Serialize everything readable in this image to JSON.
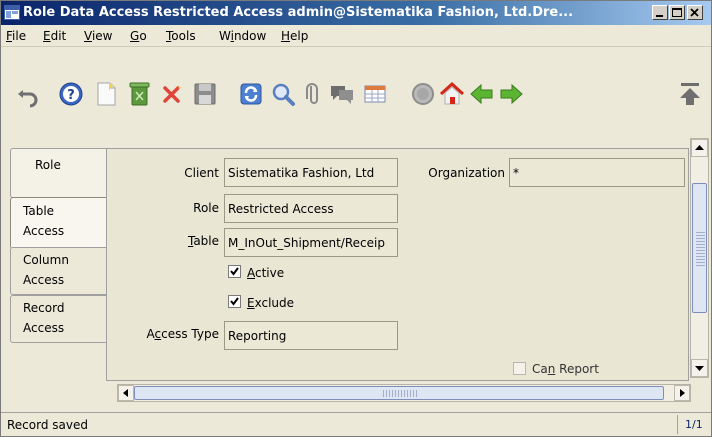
{
  "window": {
    "title": "Role Data Access  Restricted Access  admin@Sistematika Fashion, Ltd.Dre...",
    "controls": [
      "minimize",
      "maximize",
      "close"
    ]
  },
  "menu": [
    {
      "pre": "",
      "u": "F",
      "post": "ile"
    },
    {
      "pre": "",
      "u": "E",
      "post": "dit"
    },
    {
      "pre": "",
      "u": "V",
      "post": "iew"
    },
    {
      "pre": "",
      "u": "G",
      "post": "o"
    },
    {
      "pre": "",
      "u": "T",
      "post": "ools"
    },
    {
      "pre": "W",
      "u": "i",
      "post": "ndow"
    },
    {
      "pre": "",
      "u": "H",
      "post": "elp"
    }
  ],
  "toolbar": {
    "icons": [
      "undo-icon",
      "help-icon",
      "new-record-icon",
      "delete-icon",
      "delete-selection-icon",
      "save-icon",
      "refresh-icon",
      "find-icon",
      "attachment-icon",
      "chat-icon",
      "grid-toggle-icon",
      "history-icon",
      "home-icon",
      "previous-icon",
      "next-icon",
      "first-record-icon"
    ]
  },
  "tabs": [
    {
      "line1": "Role",
      "line2": ""
    },
    {
      "line1": "Table",
      "line2": "Access"
    },
    {
      "line1": "Column",
      "line2": "Access"
    },
    {
      "line1": "Record",
      "line2": "Access"
    }
  ],
  "form": {
    "client_label": "Client",
    "client_value": "Sistematika Fashion, Ltd",
    "organization_label": "Organization",
    "organization_value": "*",
    "role_label": "Role",
    "role_value": "Restricted Access",
    "table_label_u": "T",
    "table_label_rest": "able",
    "table_value": "M_InOut_Shipment/Receip",
    "active_u": "A",
    "active_rest": "ctive",
    "active_checked": true,
    "exclude_u": "E",
    "exclude_rest": "xclude",
    "exclude_checked": true,
    "access_type_pre": "A",
    "access_type_u": "c",
    "access_type_rest": "cess Type",
    "access_type_value": "Reporting",
    "can_report_pre": "Ca",
    "can_report_u": "n",
    "can_report_rest": " Report",
    "can_report_checked": false
  },
  "status": {
    "message": "Record saved",
    "record_count": "1/1"
  },
  "colors": {
    "title_start": "#0a246a",
    "title_end": "#a6caf0",
    "window_bg": "#ece9d8",
    "field_bg": "#ebe8d6"
  }
}
